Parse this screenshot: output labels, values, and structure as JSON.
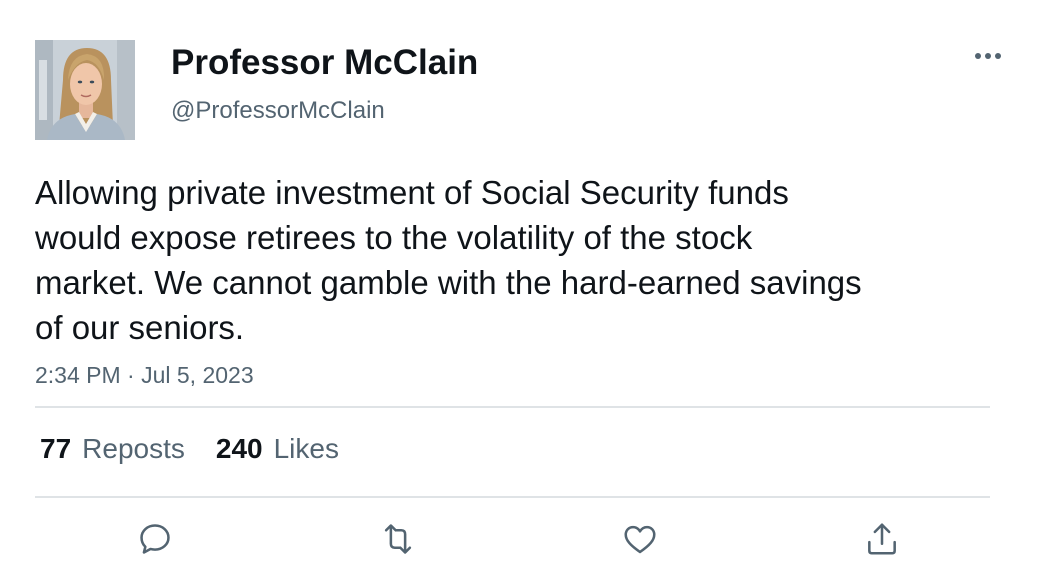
{
  "author": {
    "display_name": "Professor McClain",
    "handle": "@ProfessorMcClain",
    "avatar_icon": "profile-photo"
  },
  "tweet": {
    "text": "Allowing private investment of Social Security funds\nwould expose retirees to the volatility of the stock\nmarket. We cannot gamble with the hard-earned savings\nof our seniors.",
    "timestamp": "2:34 PM · Jul 5, 2023"
  },
  "stats": {
    "reposts_count": "77",
    "reposts_label": "Reposts",
    "likes_count": "240",
    "likes_label": "Likes"
  },
  "actions": [
    {
      "icon": "reply-icon"
    },
    {
      "icon": "repost-icon"
    },
    {
      "icon": "like-icon"
    },
    {
      "icon": "share-icon"
    }
  ],
  "menu": {
    "icon": "more-icon"
  },
  "colors": {
    "text_primary": "#0f1419",
    "text_secondary": "#536471",
    "divider": "#dfe3e6",
    "icon": "#536471"
  }
}
